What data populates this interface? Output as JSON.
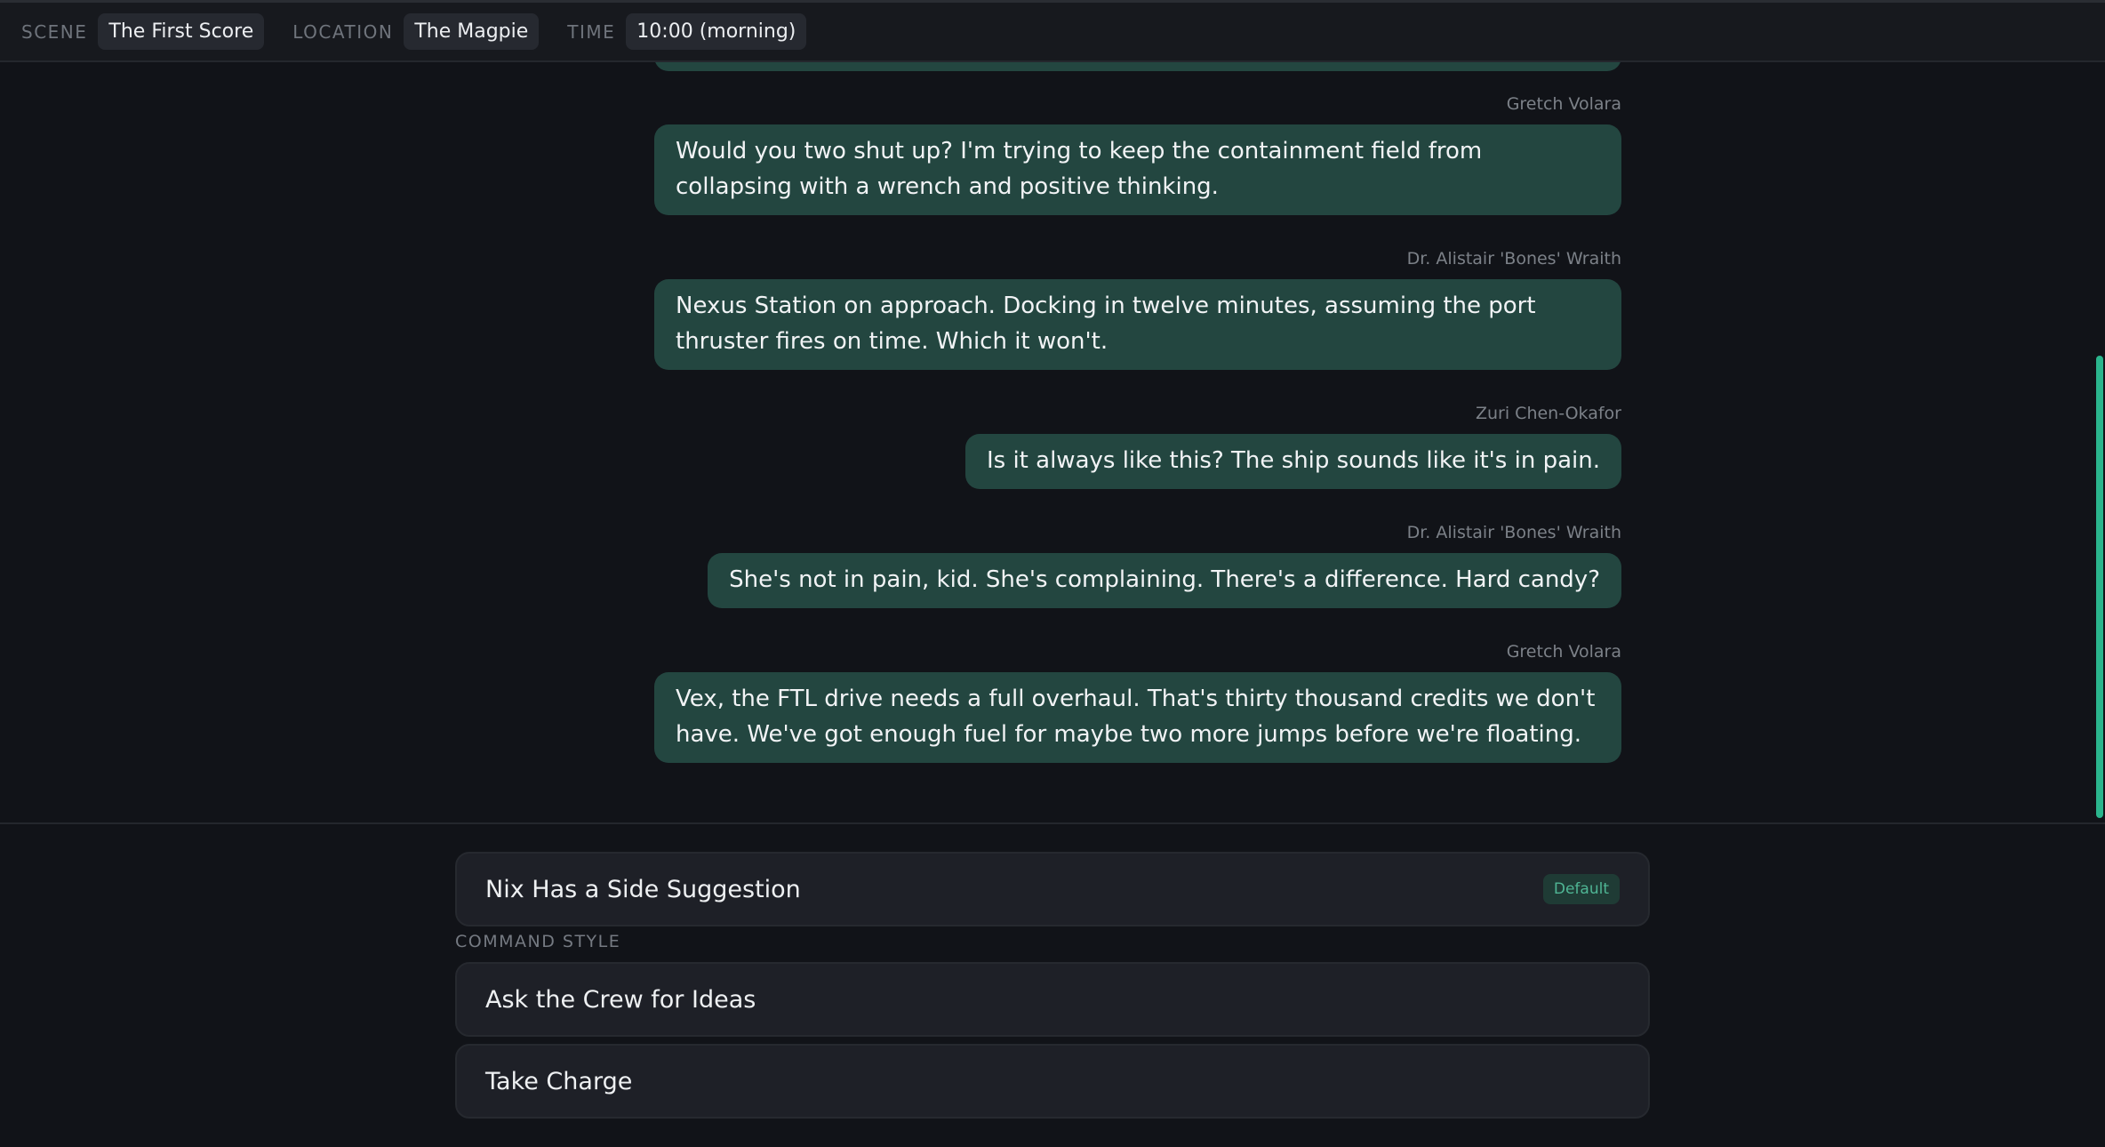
{
  "header": {
    "scene_label": "SCENE",
    "scene_value": "The First Score",
    "location_label": "LOCATION",
    "location_value": "The Magpie",
    "time_label": "TIME",
    "time_value": "10:00 (morning)"
  },
  "messages": [
    {
      "sender": "Gretch Volara",
      "text": "Would you two shut up? I'm trying to keep the containment field from collapsing with a wrench and positive thinking."
    },
    {
      "sender": "Dr. Alistair 'Bones' Wraith",
      "text": "Nexus Station on approach. Docking in twelve minutes, assuming the port thruster fires on time. Which it won't."
    },
    {
      "sender": "Zuri Chen-Okafor",
      "text": "Is it always like this? The ship sounds like it's in pain."
    },
    {
      "sender": "Dr. Alistair 'Bones' Wraith",
      "text": "She's not in pain, kid. She's complaining. There's a difference. Hard candy?"
    },
    {
      "sender": "Gretch Volara",
      "text": "Vex, the FTL drive needs a full overhaul. That's thirty thousand credits we don't have. We've got enough fuel for maybe two more jumps before we're floating."
    }
  ],
  "choices": {
    "first": {
      "label": "Nix Has a Side Suggestion",
      "badge": "Default"
    },
    "section_label": "COMMAND STYLE",
    "options": [
      {
        "label": "Ask the Crew for Ideas"
      },
      {
        "label": "Take Charge"
      }
    ]
  },
  "colors": {
    "bubble": "#234640",
    "accent": "#2bb58d",
    "background": "#111318"
  }
}
